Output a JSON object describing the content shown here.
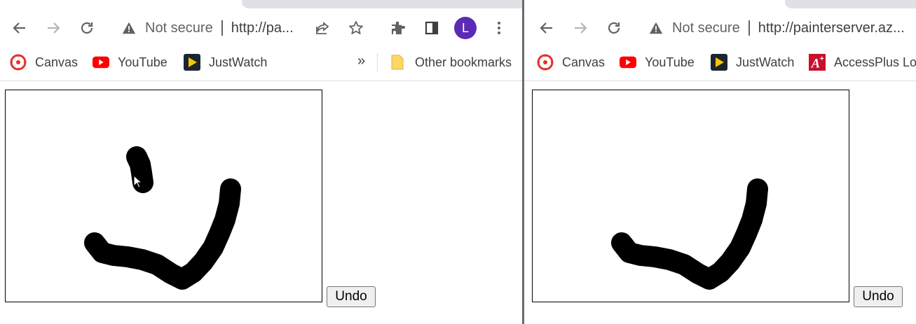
{
  "left_window": {
    "security_label": "Not secure",
    "url": "http://pa...",
    "profile_initial": "L",
    "bookmarks": [
      {
        "label": "Canvas",
        "icon": "canvas-icon"
      },
      {
        "label": "YouTube",
        "icon": "youtube-icon"
      },
      {
        "label": "JustWatch",
        "icon": "justwatch-icon"
      }
    ],
    "more_bookmarks": "»",
    "other_bookmarks": "Other bookmarks",
    "undo_label": "Undo"
  },
  "right_window": {
    "security_label": "Not secure",
    "url": "http://painterserver.az...",
    "bookmarks": [
      {
        "label": "Canvas",
        "icon": "canvas-icon"
      },
      {
        "label": "YouTube",
        "icon": "youtube-icon"
      },
      {
        "label": "JustWatch",
        "icon": "justwatch-icon"
      },
      {
        "label": "AccessPlus Log",
        "icon": "accessplus-icon"
      }
    ],
    "undo_label": "Undo"
  },
  "colors": {
    "avatar": "#5b2bb5",
    "youtube_red": "#ff0000",
    "canvas_red": "#e4332b",
    "stroke": "#000000"
  }
}
